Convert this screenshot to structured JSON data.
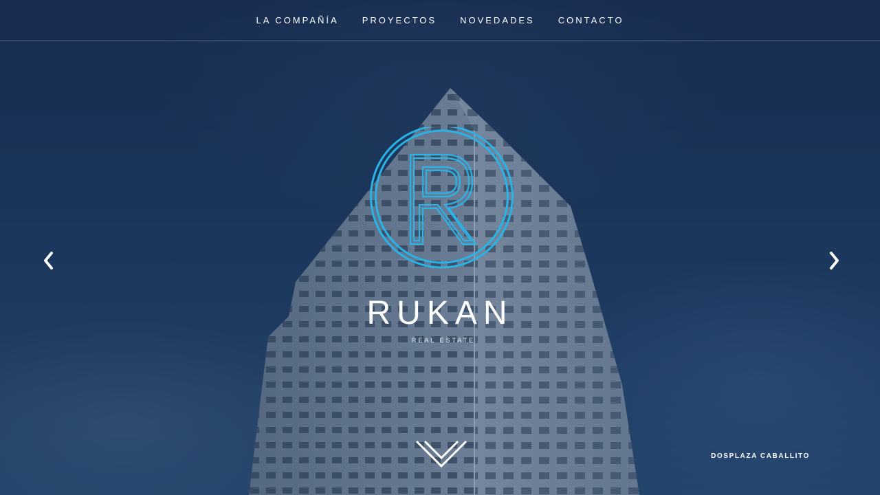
{
  "nav": {
    "items": [
      {
        "label": "LA COMPAÑÍA"
      },
      {
        "label": "PROYECTOS"
      },
      {
        "label": "NOVEDADES"
      },
      {
        "label": "CONTACTO"
      }
    ]
  },
  "hero": {
    "brand_name": "RUKAN",
    "brand_subtitle": "REAL ESTATE",
    "caption": "DOSPLAZA CABALLITO",
    "logo_letter": "R"
  },
  "icons": {
    "prev": "chevron-left-icon",
    "next": "chevron-right-icon",
    "scroll": "chevron-down-icon",
    "logo": "rukan-logo-icon"
  },
  "colors": {
    "logo_accent": "#29b3e6",
    "text": "#ffffff",
    "sky": "#1b3358"
  }
}
